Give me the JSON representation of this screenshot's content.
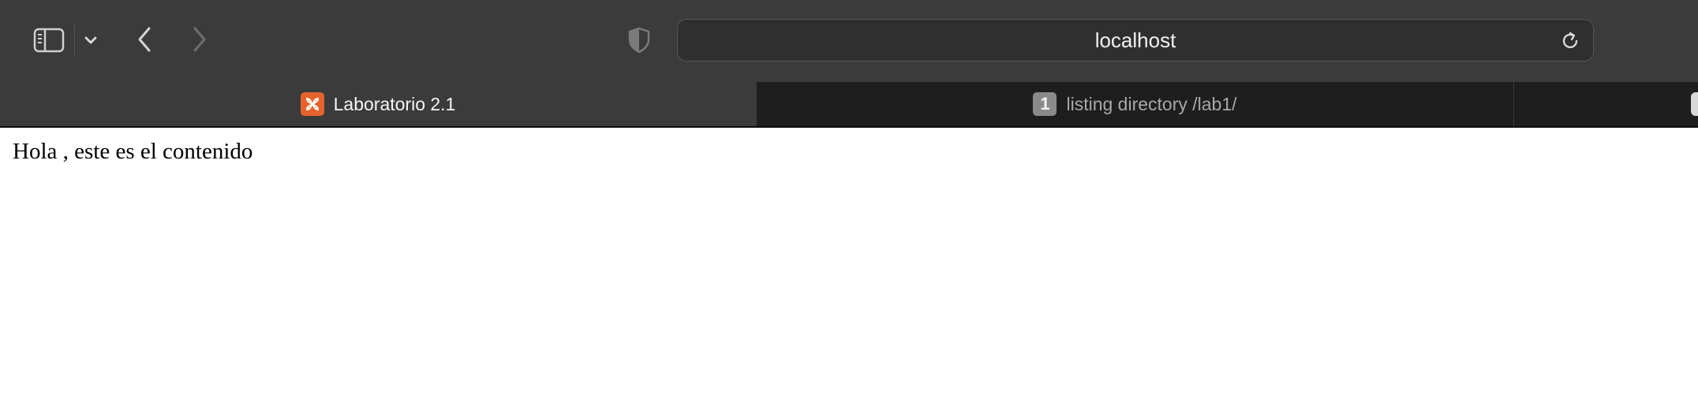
{
  "browser": {
    "address": "localhost",
    "icons": {
      "sidebar": "sidebar-icon",
      "chevron": "chevron-down-icon",
      "back": "back-icon",
      "forward": "forward-icon",
      "shield": "privacy-shield-icon",
      "reload": "reload-icon"
    }
  },
  "tabs": [
    {
      "label": "Laboratorio 2.1",
      "favicon": "xampp-icon",
      "active": true
    },
    {
      "label": "listing directory /lab1/",
      "badge": "1",
      "active": false
    },
    {
      "label": "",
      "active": false
    }
  ],
  "page": {
    "text": "Hola , este es el contenido"
  },
  "colors": {
    "toolbar": "#3b3b3b",
    "tabbar": "#1e1e1e",
    "xampp_orange": "#e6642b"
  }
}
